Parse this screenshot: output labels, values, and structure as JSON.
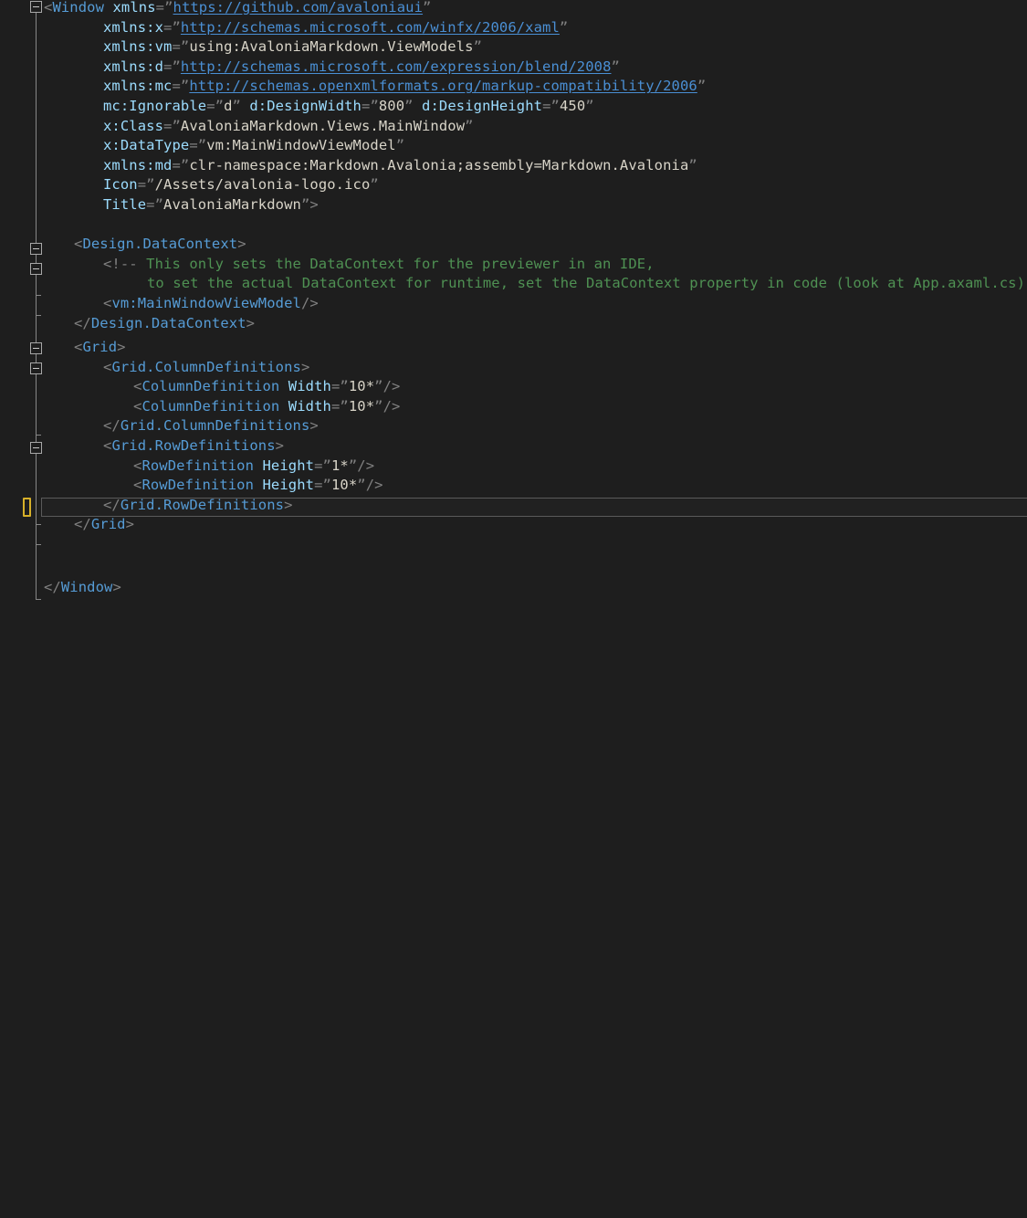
{
  "editor": {
    "language": "xaml",
    "file_root_element": "Window",
    "theme": {
      "background": "#1e1e1e",
      "current_line_background": "#212121",
      "current_line_border": "#5a5a5a",
      "tag_color": "#569cd6",
      "attribute_color": "#9cdcfe",
      "value_color": "#d8d4c8",
      "url_color": "#4a8fd4",
      "comment_color": "#4f9153",
      "punctuation_color": "#808080",
      "bookmark_color": "#d7b029",
      "fold_marker_color": "#a8a8a8"
    },
    "current_line_number": 24,
    "current_line_text": "</Grid.RowDefinitions>"
  },
  "code": {
    "lines": [
      "<Window xmlns=\"https://github.com/avaloniaui\"",
      "        xmlns:x=\"http://schemas.microsoft.com/winfx/2006/xaml\"",
      "        xmlns:vm=\"using:AvaloniaMarkdown.ViewModels\"",
      "        xmlns:d=\"http://schemas.microsoft.com/expression/blend/2008\"",
      "        xmlns:mc=\"http://schemas.openxmlformats.org/markup-compatibility/2006\"",
      "        mc:Ignorable=\"d\" d:DesignWidth=\"800\" d:DesignHeight=\"450\"",
      "        x:Class=\"AvaloniaMarkdown.Views.MainWindow\"",
      "        x:DataType=\"vm:MainWindowViewModel\"",
      "        xmlns:md=\"clr-namespace:Markdown.Avalonia;assembly=Markdown.Avalonia\"",
      "        Icon=\"/Assets/avalonia-logo.ico\"",
      "        Title=\"AvaloniaMarkdown\">",
      "",
      "    <Design.DataContext>",
      "        <!-- This only sets the DataContext for the previewer in an IDE,",
      "             to set the actual DataContext for runtime, set the DataContext property in code (look at App.axaml.cs) -->",
      "        <vm:MainWindowViewModel/>",
      "    </Design.DataContext>",
      "    <Grid>",
      "        <Grid.ColumnDefinitions>",
      "            <ColumnDefinition Width=\"10*\"/>",
      "            <ColumnDefinition Width=\"10*\"/>",
      "        </Grid.ColumnDefinitions>",
      "        <Grid.RowDefinitions>",
      "            <RowDefinition Height=\"1*\"/>",
      "            <RowDefinition Height=\"10*\"/>",
      "        </Grid.RowDefinitions>",
      "    </Grid>",
      "",
      "",
      "</Window>"
    ],
    "urls": [
      "https://github.com/avaloniaui",
      "http://schemas.microsoft.com/winfx/2006/xaml",
      "http://schemas.microsoft.com/expression/blend/2008",
      "http://schemas.openxmlformats.org/markup-compatibility/2006"
    ],
    "attributes": [
      {
        "name": "xmlns",
        "value": "https://github.com/avaloniaui"
      },
      {
        "name": "xmlns:x",
        "value": "http://schemas.microsoft.com/winfx/2006/xaml"
      },
      {
        "name": "xmlns:vm",
        "value": "using:AvaloniaMarkdown.ViewModels"
      },
      {
        "name": "xmlns:d",
        "value": "http://schemas.microsoft.com/expression/blend/2008"
      },
      {
        "name": "xmlns:mc",
        "value": "http://schemas.openxmlformats.org/markup-compatibility/2006"
      },
      {
        "name": "mc:Ignorable",
        "value": "d"
      },
      {
        "name": "d:DesignWidth",
        "value": "800"
      },
      {
        "name": "d:DesignHeight",
        "value": "450"
      },
      {
        "name": "x:Class",
        "value": "AvaloniaMarkdown.Views.MainWindow"
      },
      {
        "name": "x:DataType",
        "value": "vm:MainWindowViewModel"
      },
      {
        "name": "xmlns:md",
        "value": "clr-namespace:Markdown.Avalonia;assembly=Markdown.Avalonia"
      },
      {
        "name": "Icon",
        "value": "/Assets/avalonia-logo.ico"
      },
      {
        "name": "Title",
        "value": "AvaloniaMarkdown"
      },
      {
        "name": "Width",
        "value": "10*"
      },
      {
        "name": "Height",
        "value": "1*"
      }
    ],
    "comment_text": "<!-- This only sets the DataContext for the previewer in an IDE, to set the actual DataContext for runtime, set the DataContext property in code (look at App.axaml.cs) -->"
  },
  "tokens": {
    "l1": {
      "open": "<",
      "tag": "Window",
      "sp": " ",
      "attr": "xmlns",
      "eq": "=",
      "q1": "”",
      "url": "https://github.com/avaloniaui",
      "q2": "”"
    },
    "l2": {
      "attr": "xmlns:x",
      "eq": "=",
      "q1": "”",
      "url": "http://schemas.microsoft.com/winfx/2006/xaml",
      "q2": "”"
    },
    "l3": {
      "attr": "xmlns:vm",
      "eq": "=",
      "q1": "”",
      "val": "using:AvaloniaMarkdown.ViewModels",
      "q2": "”"
    },
    "l4": {
      "attr": "xmlns:d",
      "eq": "=",
      "q1": "”",
      "url": "http://schemas.microsoft.com/expression/blend/2008",
      "q2": "”"
    },
    "l5": {
      "attr": "xmlns:mc",
      "eq": "=",
      "q1": "”",
      "url": "http://schemas.openxmlformats.org/markup-compatibility/2006",
      "q2": "”"
    },
    "l6": {
      "a1": "mc:Ignorable",
      "v1": "d",
      "a2": "d:DesignWidth",
      "v2": "800",
      "a3": "d:DesignHeight",
      "v3": "450"
    },
    "l7": {
      "attr": "x:Class",
      "val": "AvaloniaMarkdown.Views.MainWindow"
    },
    "l8": {
      "attr": "x:DataType",
      "val": "vm:MainWindowViewModel"
    },
    "l9": {
      "attr": "xmlns:md",
      "val": "clr-namespace:Markdown.Avalonia;assembly=Markdown.Avalonia"
    },
    "l10": {
      "attr": "Icon",
      "val": "/Assets/avalonia-logo.ico"
    },
    "l11": {
      "attr": "Title",
      "val": "AvaloniaMarkdown",
      "close": ">"
    },
    "l13": {
      "open": "<",
      "tag": "Design.DataContext",
      "close": ">"
    },
    "l14": {
      "mark": "<!--",
      "text": " This only sets the DataContext for the previewer in an IDE,"
    },
    "l15": {
      "text": "to set the actual DataContext for runtime, set the DataContext property in code (look at App.axaml.cs)",
      "mark": "-->"
    },
    "l16": {
      "open": "<",
      "tag": "vm:MainWindowViewModel",
      "close": "/>"
    },
    "l17": {
      "open": "</",
      "tag": "Design.DataContext",
      "close": ">"
    },
    "l18": {
      "open": "<",
      "tag": "Grid",
      "close": ">"
    },
    "l19": {
      "open": "<",
      "tag": "Grid.ColumnDefinitions",
      "close": ">"
    },
    "l20": {
      "open": "<",
      "tag": "ColumnDefinition",
      "attr": "Width",
      "val": "10*",
      "close": "/>"
    },
    "l21": {
      "open": "<",
      "tag": "ColumnDefinition",
      "attr": "Width",
      "val": "10*",
      "close": "/>"
    },
    "l22": {
      "open": "</",
      "tag": "Grid.ColumnDefinitions",
      "close": ">"
    },
    "l23": {
      "open": "<",
      "tag": "Grid.RowDefinitions",
      "close": ">"
    },
    "l24": {
      "open": "<",
      "tag": "RowDefinition",
      "attr": "Height",
      "val": "1*",
      "close": "/>"
    },
    "l25": {
      "open": "<",
      "tag": "RowDefinition",
      "attr": "Height",
      "val": "10*",
      "close": "/>"
    },
    "l26": {
      "open": "</",
      "tag": "Grid.RowDefinitions",
      "close": ">"
    },
    "l27": {
      "open": "</",
      "tag": "Grid",
      "close": ">"
    },
    "l30": {
      "open": "</",
      "tag": "Window",
      "close": ">"
    }
  },
  "gutter": {
    "fold_markers_expanded": 6,
    "bookmark_count": 1,
    "bookmark_line": 26
  }
}
